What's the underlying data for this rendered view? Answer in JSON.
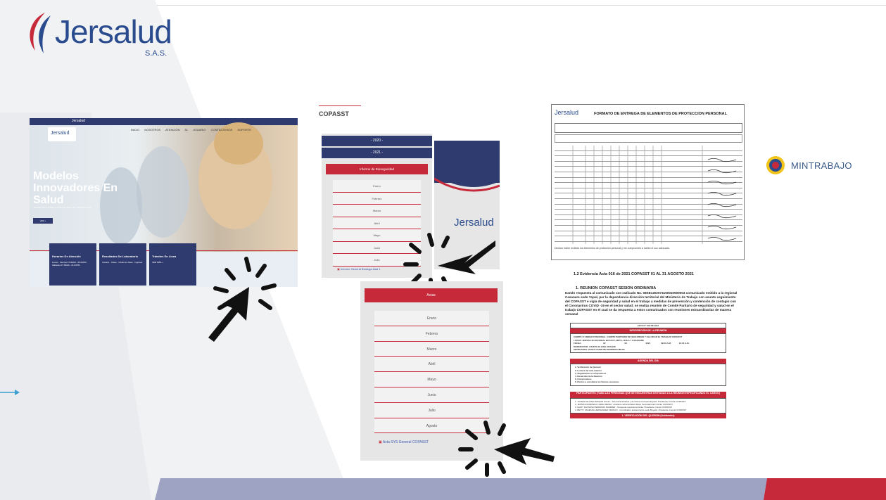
{
  "logo": {
    "name": "Jersalud",
    "suffix": "S.A.S."
  },
  "colors": {
    "navy": "#2f3a6e",
    "red": "#c6293a",
    "brand_blue": "#2a4c8e",
    "bottom_bar": "#9ea3c3",
    "bottom_red": "#c6293a"
  },
  "website": {
    "nav_text": "Jersalud",
    "menu": "INICIO NOSOTROS ATENCIÓN AL USUARIO CONTÁCTENOS SOPORTE",
    "title": "Modelos Innovadores En Salud",
    "description": "Jersalud S.A.S. brinda servicios de salud con calidad humana",
    "cta": "VER +",
    "cards": [
      {
        "title": "Horarios De Atención",
        "sub": "Lunes - Viernes 07:00AM - 05:00PM · Sábados 07:00AM - 01:00PM"
      },
      {
        "title": "Resultados De Laboratorio",
        "sub": "Usuario · Clave · Olvidó su clave · Ingresar"
      },
      {
        "title": "Trámites En Línea",
        "sub": "VER MÁS +"
      }
    ]
  },
  "copasst": {
    "label": "COPASST",
    "years": [
      "- 2020 -",
      "- 2021 -"
    ],
    "section": "Informe de Bioseguridad",
    "months": [
      "Enero",
      "Febrero",
      "Marzo",
      "Abril",
      "Mayo",
      "Junio",
      "Julio"
    ],
    "link": "Informe General Bioseguridad 1"
  },
  "actas": {
    "title": "Actas",
    "months": [
      "Enero",
      "Febrero",
      "Marzo",
      "Abril",
      "Mayo",
      "Junio",
      "Julio",
      "Agosto"
    ],
    "link": "Acta SYS General COPASST"
  },
  "form": {
    "title": "FORMATO DE ENTREGA DE ELEMENTOS DE PROTECCION PERSONAL",
    "footer": "Declaro haber recibido los elementos de protección personal y me comprometo a darles el uso adecuado."
  },
  "evidence": {
    "title": "1.2 Evidencia Acta 016 de 2021 COPASST 01 AL 31 AGOSTO 2021",
    "heading": "1. REUNION COPASST SESION ORDINARIA",
    "paragraph": "Dando respuesta al comunicado con radicado No. 08SE1202074150010000004 comunicado emitido a la regional Casanare sede Yopal, por la dependencia dirección territorial del Ministerio de Trabajo con asunto seguimiento del COPASST e vigía de seguridad y salud en el trabajo a medidas de prevención y contención de contagio con el Coronavirus COVID -19 en el sector salud; se realiza reunión de Comité Paritario de seguridad y salud en el trabajo COPASST en el cual se da respuesta a estos comunicados con reuniones extraordinarias de manera semanal",
    "table": {
      "acta": "ACTA N° 016 DE 2021",
      "desc_head": "DESCRIPCIÓN DE LA REUNIÓN",
      "comite_label": "COMITÉ O UNIDAD FUNCIONAL:",
      "comite": "COMITÉ PARITARIO DE SEGURIDAD Y SALUD EN EL TRABAJO COPASST",
      "lugar": "LUGAR: JERSALUD NACIONAL BOYACÁ, META, HUILA Y CASANARE",
      "fecha_label": "FECHA:",
      "dd": "02",
      "mm": "09",
      "aa": "2021",
      "hora_inicio": "09:00 A.M.",
      "hora_fin": "10:10 A.M.",
      "moderador": "MODERADOR: JULIETH ELIANA ARAQUE",
      "secretaria": "SECRETARIA: DIANA CAROLINA BARRERA MEJIA",
      "agenda_head": "AGENDA DEL DÍA",
      "agenda": [
        "1. Verificación de Quorum",
        "2. Lectura del acta anterior",
        "3. Seguimiento a compromisos",
        "4. Desarrollo de la Reunión",
        "5. Compromisos",
        "6. Puntos a considerar en futuras reuniones"
      ],
      "part_head": "PARTICIPANTES (Todas LAS PERSONAS QUE SE ENCUENTRAN INVITADAS A LA REUNIÓN ESPECIFICANDO EL CARGO)",
      "participants": [
        "1. JULIETH ELIANA ARAQUE OCHA - Jefe administrativa y de talento humano Boyacá. Presidente Comité COPASST.",
        "2. JESSICA MARCELA CARDA REINA - Asistente administrativa Meta. Secretaria del Comité COPASST.",
        "3. LEIDY DAYANNA PERDOMO RAMIREZ - Terapeuta respiratoria Huila. Presidente Comité COPASST.",
        "4. BETTY VANESSA HERNANDEZ FRANCO - Coordinador asistencial de sede Boyacá. Presidente Comité COPASST."
      ],
      "verif": "1. VERIFICACIÓN DEL QUORUM (Asistentes)"
    }
  },
  "mintrabajo": {
    "label": "MINTRABAJO"
  }
}
